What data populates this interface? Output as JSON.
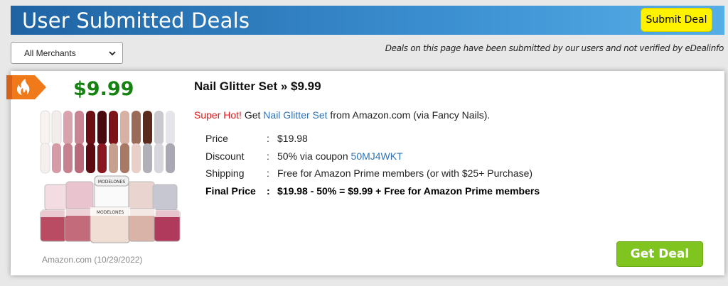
{
  "header": {
    "title": "User Submitted Deals",
    "submit_label": "Submit Deal"
  },
  "filter": {
    "merchant_selected": "All Merchants",
    "icon": "chevron-down-icon"
  },
  "disclaimer": "Deals on this page have been submitted by our users and not verified by eDealinfo",
  "deal": {
    "hot_icon": "flame-icon",
    "price": "$9.99",
    "title": "Nail Glitter Set » $9.99",
    "desc": {
      "hot": "Super Hot!",
      "get": " Get ",
      "product_link": "Nail Glitter Set",
      "rest": " from Amazon.com (via Fancy Nails)."
    },
    "details": {
      "price_label": "Price",
      "price_value": "$19.98",
      "discount_label": "Discount",
      "discount_value": "50% via coupon ",
      "coupon_code": "50MJ4WKT",
      "shipping_label": "Shipping",
      "shipping_value": "Free for Amazon Prime members (or with $25+ Purchase)",
      "final_label": "Final Price",
      "final_value": "$19.98 - 50% = $9.99 + Free for Amazon Prime members",
      "separator": ":"
    },
    "image_text": "MODELONES",
    "store_date": "Amazon.com (10/29/2022)",
    "get_deal_label": "Get Deal"
  },
  "colors": {
    "price_green": "#14820f",
    "hot_red": "#e21a1a",
    "link_blue": "#2f73b5",
    "button_green": "#80c41f",
    "submit_yellow": "#fff200",
    "tag_orange": "#f07a1a"
  }
}
